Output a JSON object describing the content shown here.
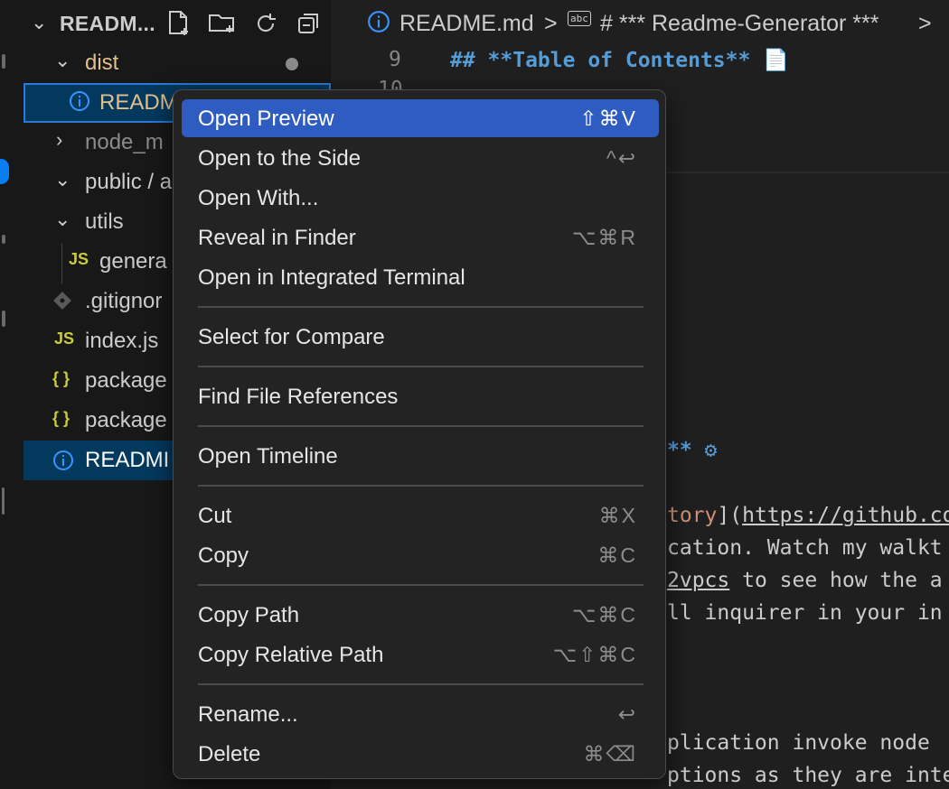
{
  "explorer": {
    "title": "READM...",
    "actions": [
      {
        "name": "new-file-icon"
      },
      {
        "name": "new-folder-icon"
      },
      {
        "name": "refresh-icon"
      },
      {
        "name": "collapse-all-icon"
      }
    ],
    "items": [
      {
        "label": "dist",
        "type": "folder-open"
      },
      {
        "label": "READM",
        "type": "info-file"
      },
      {
        "label": "node_m",
        "type": "folder-closed"
      },
      {
        "label": "public / a",
        "type": "folder-open"
      },
      {
        "label": "utils",
        "type": "folder-open"
      },
      {
        "label": "genera",
        "type": "js"
      },
      {
        "label": ".gitignor",
        "type": "git"
      },
      {
        "label": "index.js",
        "type": "js"
      },
      {
        "label": "package",
        "type": "json"
      },
      {
        "label": "package",
        "type": "json"
      },
      {
        "label": "READMI",
        "type": "info-file"
      }
    ],
    "js_glyph": "JS",
    "json_glyph": "{ }",
    "info_glyph": "i"
  },
  "breadcrumbs": {
    "file": "README.md",
    "sep": ">",
    "symbol": "# *** Readme-Generator ***",
    "abc": "abc"
  },
  "editor": {
    "line9_num": "9",
    "line9_code": "## **Table of Contents** 📄",
    "line10_num": "10",
    "frag1": "** ⚙",
    "frag2a": "tory",
    "frag2b": "](",
    "frag2c": "https://github.co",
    "frag3": "cation. Watch my walkt",
    "frag4a": "2vpcs",
    "frag4b": " to see how the a",
    "frag5": "ll inquirer in your in",
    "frag6": "plication invoke node",
    "frag7": "ptions as they are inte"
  },
  "context_menu": {
    "items": [
      {
        "label": "Open Preview",
        "shortcut": "⇧⌘V"
      },
      {
        "label": "Open to the Side",
        "shortcut": "^↩"
      },
      {
        "label": "Open With...",
        "shortcut": ""
      },
      {
        "label": "Reveal in Finder",
        "shortcut": "⌥⌘R"
      },
      {
        "label": "Open in Integrated Terminal",
        "shortcut": ""
      },
      {
        "label": "Select for Compare",
        "shortcut": ""
      },
      {
        "label": "Find File References",
        "shortcut": ""
      },
      {
        "label": "Open Timeline",
        "shortcut": ""
      },
      {
        "label": "Cut",
        "shortcut": "⌘X"
      },
      {
        "label": "Copy",
        "shortcut": "⌘C"
      },
      {
        "label": "Copy Path",
        "shortcut": "⌥⌘C"
      },
      {
        "label": "Copy Relative Path",
        "shortcut": "⌥⇧⌘C"
      },
      {
        "label": "Rename...",
        "shortcut": "↩"
      },
      {
        "label": "Delete",
        "shortcut": "⌘⌫"
      }
    ]
  },
  "colors": {
    "accent": "#2f5cc0",
    "selection": "#04395e",
    "js": "#cbcb41",
    "json": "#cbcb41",
    "info": "#3794ff",
    "markdown_heading": "#569cd6"
  }
}
